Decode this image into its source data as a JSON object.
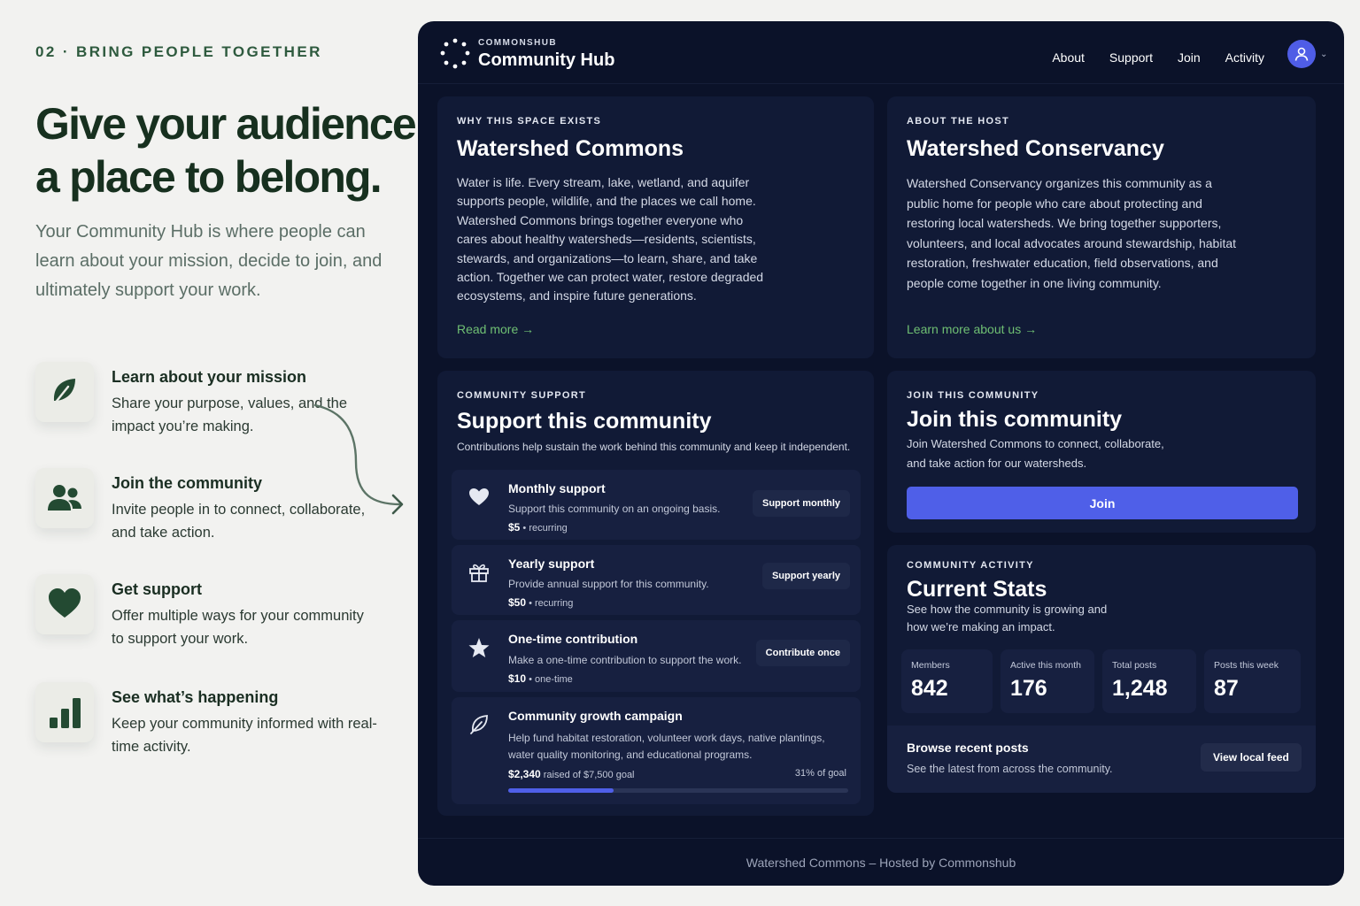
{
  "eyebrow": "02 · BRING PEOPLE TOGETHER",
  "headline_line1": "Give your audience",
  "headline_line2": "a place to belong.",
  "lead": "Your Community Hub is where people can learn about your mission, decide to join, and ultimately support your work.",
  "features": [
    {
      "icon": "leaf-icon",
      "title": "Learn about your mission",
      "desc": "Share your purpose, values, and the impact you’re making."
    },
    {
      "icon": "people-icon",
      "title": "Join the community",
      "desc": "Invite people in to connect, collaborate, and take action."
    },
    {
      "icon": "heart-icon",
      "title": "Get support",
      "desc": "Offer multiple ways for your community to support your work."
    },
    {
      "icon": "bar-chart-icon",
      "title": "See what’s happening",
      "desc": "Keep your community informed with real-time activity."
    }
  ],
  "colors": {
    "brand_green": "#2e5a3e",
    "panel_bg": "#0b1229",
    "accent_blue": "#4f5fe8",
    "link_green": "#6fbf73"
  },
  "app": {
    "brand_small": "COMMONSHUB",
    "brand_big": "Community Hub",
    "nav": [
      "About",
      "Support",
      "Join",
      "Activity"
    ],
    "why": {
      "kicker": "WHY THIS SPACE EXISTS",
      "title": "Watershed Commons",
      "body": "Water is life. Every stream, lake, wetland, and aquifer supports people, wildlife, and the places we call home. Watershed Commons brings together everyone who cares about healthy watersheds—residents, scientists, stewards, and organizations—to learn, share, and take action. Together we can protect water, restore degraded ecosystems, and inspire future generations.",
      "link": "Read more →"
    },
    "host": {
      "kicker": "ABOUT THE HOST",
      "title": "Watershed Conservancy",
      "body": "Watershed Conservancy organizes this community as a public home for people who care about protecting and restoring local watersheds. We bring together supporters, volunteers, and local advocates around stewardship, habitat restoration, freshwater education, field observations, and people come together in one living community.",
      "link": "Learn more about us →"
    },
    "support": {
      "kicker": "COMMUNITY SUPPORT",
      "title": "Support this community",
      "subtitle": "Contributions help sustain the work behind this community and keep it independent.",
      "options": [
        {
          "icon": "heart-icon",
          "title": "Monthly support",
          "desc": "Support this community on an ongoing basis.",
          "amount": "$5",
          "freq": " • recurring",
          "button": "Support monthly"
        },
        {
          "icon": "gift-icon",
          "title": "Yearly support",
          "desc": "Provide annual support for this community.",
          "amount": "$50",
          "freq": " • recurring",
          "button": "Support yearly"
        },
        {
          "icon": "star-icon",
          "title": "One-time contribution",
          "desc": "Make a one-time contribution to support the work.",
          "amount": "$10",
          "freq": " • one-time",
          "button": "Contribute once"
        }
      ],
      "campaign": {
        "icon": "leaf-icon",
        "title": "Community growth campaign",
        "desc": "Help fund habitat restoration, volunteer work days, native plantings, water quality monitoring, and educational programs.",
        "raised": "$2,340",
        "raised_text": " raised of $7,500 goal",
        "percent_label": "31% of goal",
        "progress": 0.31
      }
    },
    "join": {
      "kicker": "JOIN THIS COMMUNITY",
      "title": "Join this community",
      "body": "Join Watershed Commons to connect, collaborate, and take action for our watersheds.",
      "button": "Join"
    },
    "stats": {
      "kicker": "COMMUNITY ACTIVITY",
      "title": "Current Stats",
      "body": "See how the community is growing and how we’re making an impact.",
      "items": [
        {
          "label": "Members",
          "value": "842"
        },
        {
          "label": "Active this month",
          "value": "176"
        },
        {
          "label": "Total posts",
          "value": "1,248"
        },
        {
          "label": "Posts this week",
          "value": "87"
        }
      ],
      "browse_title": "Browse recent posts",
      "browse_desc": "See the latest from across the community.",
      "browse_button": "View local feed"
    },
    "footer": "Watershed Commons – Hosted by Commonshub"
  }
}
